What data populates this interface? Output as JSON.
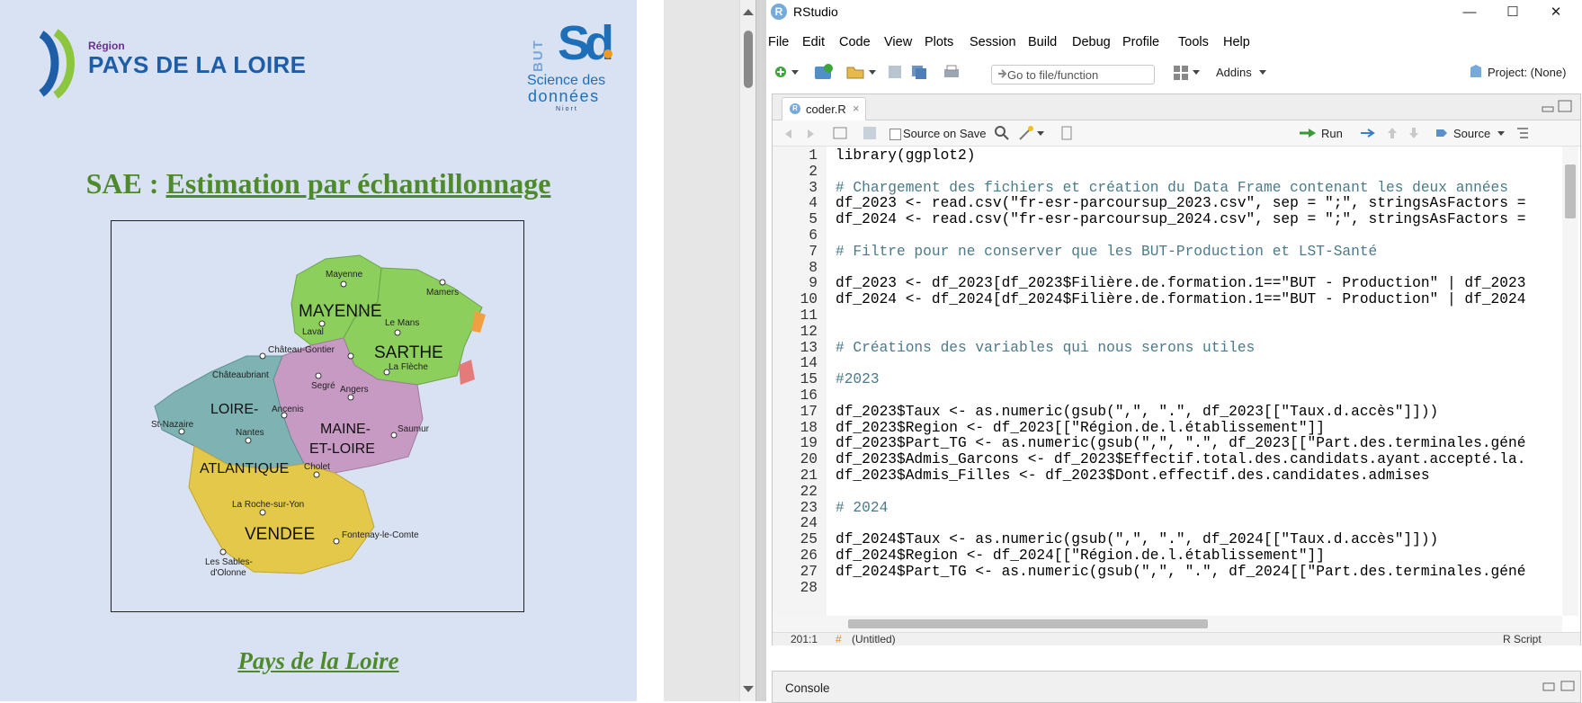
{
  "document": {
    "region_logo": {
      "small": "Région",
      "name": "PAYS DE LA LOIRE"
    },
    "but_logo": {
      "vertical": "BUT",
      "line1": "Science des",
      "line2": "données",
      "city": "Niort"
    },
    "title_prefix": "SAE :",
    "title_main": "Estimation par échantillonnage",
    "map": {
      "departments": [
        {
          "name": "MAYENNE",
          "color": "#8ccf5d"
        },
        {
          "name": "SARTHE",
          "color": "#8ccf5d"
        },
        {
          "name": "LOIRE-",
          "color": "#7fb3b3"
        },
        {
          "name": "ATLANTIQUE",
          "color": "#7fb3b3"
        },
        {
          "name": "MAINE-",
          "color": "#c79ac4"
        },
        {
          "name": "ET-LOIRE",
          "color": "#c79ac4"
        },
        {
          "name": "VENDEE",
          "color": "#e3c84a"
        }
      ],
      "cities": [
        "Mayenne",
        "Mamers",
        "Laval",
        "Le Mans",
        "Château-Gontier",
        "La Flèche",
        "Châteaubriant",
        "Segré",
        "Angers",
        "Ancenis",
        "St-Nazaire",
        "Nantes",
        "Saumur",
        "Cholet",
        "La Roche-sur-Yon",
        "Fontenay-le-Comte",
        "Les Sables-",
        "d'Olonne"
      ]
    },
    "subtitle": "Pays de la Loire"
  },
  "rstudio": {
    "title": "RStudio",
    "window_controls": [
      "—",
      "☐",
      "✕"
    ],
    "menu": [
      "File",
      "Edit",
      "Code",
      "View",
      "Plots",
      "Session",
      "Build",
      "Debug",
      "Profile",
      "Tools",
      "Help"
    ],
    "toolbar": {
      "goto_placeholder": "Go to file/function",
      "addins": "Addins",
      "project": "Project: (None)"
    },
    "tab": {
      "label": "coder.R",
      "close": "×"
    },
    "editor_tools": {
      "source_on_save": "Source on Save",
      "run": "Run",
      "source": "Source"
    },
    "code_lines": [
      {
        "n": "1",
        "t": "library(ggplot2)"
      },
      {
        "n": "2",
        "t": ""
      },
      {
        "n": "3",
        "t": "# Chargement des fichiers et création du Data Frame contenant les deux années"
      },
      {
        "n": "4",
        "t": "df_2023 <- read.csv(\"fr-esr-parcoursup_2023.csv\", sep = \";\", stringsAsFactors ="
      },
      {
        "n": "5",
        "t": "df_2024 <- read.csv(\"fr-esr-parcoursup_2024.csv\", sep = \";\", stringsAsFactors ="
      },
      {
        "n": "6",
        "t": ""
      },
      {
        "n": "7",
        "t": "# Filtre pour ne conserver que les BUT-Production et LST-Santé"
      },
      {
        "n": "8",
        "t": ""
      },
      {
        "n": "9",
        "t": "df_2023 <- df_2023[df_2023$Filière.de.formation.1==\"BUT - Production\" | df_2023"
      },
      {
        "n": "10",
        "t": "df_2024 <- df_2024[df_2024$Filière.de.formation.1==\"BUT - Production\" | df_2024"
      },
      {
        "n": "11",
        "t": ""
      },
      {
        "n": "12",
        "t": ""
      },
      {
        "n": "13",
        "t": "# Créations des variables qui nous serons utiles"
      },
      {
        "n": "14",
        "t": ""
      },
      {
        "n": "15",
        "t": "#2023"
      },
      {
        "n": "16",
        "t": ""
      },
      {
        "n": "17",
        "t": "df_2023$Taux <- as.numeric(gsub(\",\", \".\", df_2023[[\"Taux.d.accès\"]]))"
      },
      {
        "n": "18",
        "t": "df_2023$Region <- df_2023[[\"Région.de.l.établissement\"]]"
      },
      {
        "n": "19",
        "t": "df_2023$Part_TG <- as.numeric(gsub(\",\", \".\", df_2023[[\"Part.des.terminales.géné"
      },
      {
        "n": "20",
        "t": "df_2023$Admis_Garcons <- df_2023$Effectif.total.des.candidats.ayant.accepté.la."
      },
      {
        "n": "21",
        "t": "df_2023$Admis_Filles <- df_2023$Dont.effectif.des.candidates.admises"
      },
      {
        "n": "22",
        "t": ""
      },
      {
        "n": "23",
        "t": "# 2024"
      },
      {
        "n": "24",
        "t": ""
      },
      {
        "n": "25",
        "t": "df_2024$Taux <- as.numeric(gsub(\",\", \".\", df_2024[[\"Taux.d.accès\"]]))"
      },
      {
        "n": "26",
        "t": "df_2024$Region <- df_2024[[\"Région.de.l.établissement\"]]"
      },
      {
        "n": "27",
        "t": "df_2024$Part_TG <- as.numeric(gsub(\",\", \".\", df_2024[[\"Part.des.terminales.géné"
      },
      {
        "n": "28",
        "t": ""
      }
    ],
    "status": {
      "position": "201:1",
      "scope": "(Untitled)",
      "filetype": "R Script"
    },
    "console_label": "Console"
  }
}
